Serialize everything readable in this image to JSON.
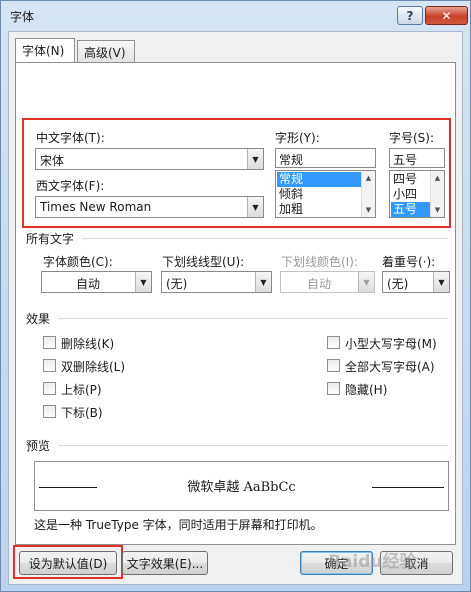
{
  "window": {
    "title": "字体",
    "help_label": "?",
    "close_label": "✕"
  },
  "tabs": [
    {
      "label": "字体(N)",
      "active": true
    },
    {
      "label": "高级(V)",
      "active": false
    }
  ],
  "font": {
    "chinese_font_label": "中文字体(T):",
    "chinese_font_value": "宋体",
    "western_font_label": "西文字体(F):",
    "western_font_value": "Times New Roman",
    "style_label": "字形(Y):",
    "style_value": "常规",
    "style_options": [
      "常规",
      "倾斜",
      "加粗"
    ],
    "size_label": "字号(S):",
    "size_value": "五号",
    "size_options": [
      "四号",
      "小四",
      "五号"
    ]
  },
  "all_text": {
    "section_title": "所有文字",
    "font_color_label": "字体颜色(C):",
    "font_color_value": "自动",
    "underline_style_label": "下划线线型(U):",
    "underline_style_value": "(无)",
    "underline_color_label": "下划线颜色(I):",
    "underline_color_value": "自动",
    "emphasis_label": "着重号(·):",
    "emphasis_value": "(无)"
  },
  "effects": {
    "section_title": "效果",
    "left": [
      "删除线(K)",
      "双删除线(L)",
      "上标(P)",
      "下标(B)"
    ],
    "right": [
      "小型大写字母(M)",
      "全部大写字母(A)",
      "隐藏(H)"
    ]
  },
  "preview": {
    "section_title": "预览",
    "sample": "微软卓越  AaBbCc",
    "note": "这是一种 TrueType 字体，同时适用于屏幕和打印机。"
  },
  "buttons": {
    "set_default": "设为默认值(D)",
    "text_effects": "文字效果(E)...",
    "ok": "确定",
    "cancel": "取消"
  },
  "watermark": "Baidu经验",
  "colors": {
    "highlight_box": "#e0312c",
    "selection": "#3399ff",
    "title_bar": "#c6d9ef"
  }
}
